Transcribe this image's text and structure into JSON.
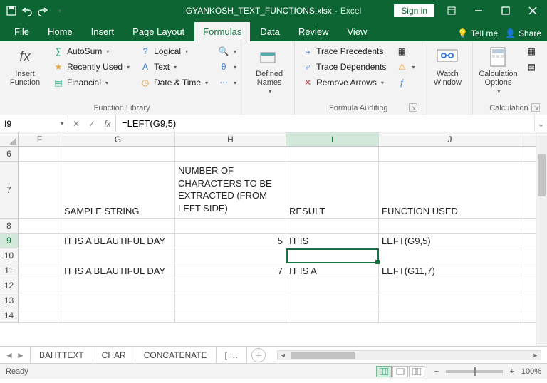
{
  "title": {
    "filename": "GYANKOSH_TEXT_FUNCTIONS.xlsx",
    "app": "Excel",
    "signin": "Sign in"
  },
  "tabs": {
    "file": "File",
    "home": "Home",
    "insert": "Insert",
    "page_layout": "Page Layout",
    "formulas": "Formulas",
    "data": "Data",
    "review": "Review",
    "view": "View",
    "tellme": "Tell me",
    "share": "Share"
  },
  "ribbon": {
    "insert_function": "Insert Function",
    "autosum": "AutoSum",
    "recently_used": "Recently Used",
    "financial": "Financial",
    "logical": "Logical",
    "text": "Text",
    "date_time": "Date & Time",
    "defined_names": "Defined Names",
    "trace_precedents": "Trace Precedents",
    "trace_dependents": "Trace Dependents",
    "remove_arrows": "Remove Arrows",
    "watch_window": "Watch Window",
    "calc_options": "Calculation Options",
    "grp_function_library": "Function Library",
    "grp_formula_auditing": "Formula Auditing",
    "grp_calculation": "Calculation"
  },
  "namebox": "I9",
  "formula": "=LEFT(G9,5)",
  "cols": [
    "F",
    "G",
    "H",
    "I",
    "J"
  ],
  "rows": [
    "6",
    "7",
    "8",
    "9",
    "10",
    "11",
    "12",
    "13",
    "14"
  ],
  "cells": {
    "H6": "NUMBER OF CHARACTERS TO BE EXTRACTED (FROM LEFT SIDE)",
    "G7": "SAMPLE STRING",
    "I7": "RESULT",
    "J7": "FUNCTION USED",
    "G9": "IT IS A BEAUTIFUL DAY",
    "H9": "5",
    "I9": "IT IS",
    "J9": "LEFT(G9,5)",
    "G11": "IT IS A BEAUTIFUL DAY",
    "H11": "7",
    "I11": "IT IS A",
    "J11": "LEFT(G11,7)"
  },
  "sheets": {
    "s1": "BAHTTEXT",
    "s2": "CHAR",
    "s3": "CONCATENATE",
    "more": "[ …"
  },
  "status": {
    "ready": "Ready",
    "zoom": "100%"
  }
}
